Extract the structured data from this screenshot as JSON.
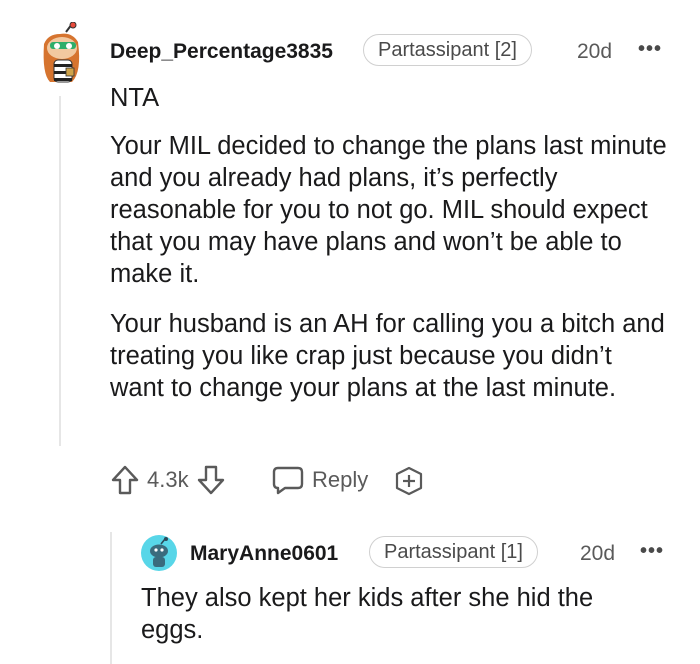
{
  "comment": {
    "username": "Deep_Percentage3835",
    "flair": "Partassipant [2]",
    "age": "20d",
    "more_label": "•••",
    "verdict": "NTA",
    "paragraphs": [
      "Your MIL decided to change the plans last minute and you already had plans, it’s perfectly reasonable for you to not go. MIL should expect that you may have plans and won’t be able to make it.",
      "Your husband is an AH for calling you a bitch and treating you like crap just because you didn’t want to change your plans at the last minute."
    ],
    "vote_count": "4.3k",
    "reply_label": "Reply",
    "icons": [
      "avatar-snoo-icon",
      "upvote-arrow-icon",
      "downvote-arrow-icon",
      "reply-bubble-icon",
      "award-plus-icon",
      "more-options-icon"
    ]
  },
  "reply": {
    "username": "MaryAnne0601",
    "flair": "Partassipant [1]",
    "age": "20d",
    "more_label": "•••",
    "text": "They also kept her kids after she hid the eggs."
  },
  "colors": {
    "text": "#1a1a1b",
    "muted": "#5a5a5a",
    "avatar2_bg": "#58d6e8",
    "thread_line": "#e6e6e6"
  }
}
